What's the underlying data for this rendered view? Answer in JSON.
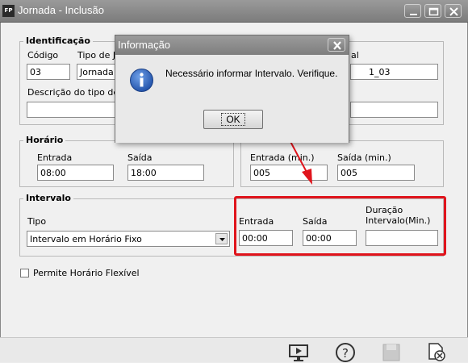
{
  "window": {
    "app_icon_text": "FP",
    "title": "Jornada - Inclusão"
  },
  "identificacao": {
    "group_title": "Identificação",
    "codigo_label": "Código",
    "codigo_value": "03",
    "tipo_label": "Tipo de Jo",
    "tipo_value": "Jornada",
    "partial_label": "al",
    "partial_value": "1_03",
    "descricao_label": "Descrição do tipo de Jo",
    "descricao_value": ""
  },
  "horario": {
    "group_title": "Horário",
    "entrada_label": "Entrada",
    "entrada_value": "08:00",
    "saida_label": "Saída",
    "saida_value": "18:00"
  },
  "variacoes": {
    "entrada_label": "Entrada (min.)",
    "entrada_value": "005",
    "saida_label": "Saída (min.)",
    "saida_value": "005"
  },
  "intervalo": {
    "group_title": "Intervalo",
    "tipo_label": "Tipo",
    "tipo_value": "Intervalo em Horário Fixo",
    "entrada_label": "Entrada",
    "entrada_value": "00:00",
    "saida_label": "Saída",
    "saida_value": "00:00",
    "duracao_label_line1": "Duração",
    "duracao_label_line2": "Intervalo(Min.)",
    "duracao_value": ""
  },
  "flexivel": {
    "label": "Permite Horário Flexível",
    "checked": false
  },
  "dialog": {
    "title": "Informação",
    "message": "Necessário informar Intervalo. Verifique.",
    "ok_label": "OK"
  },
  "toolbar": {
    "icons": [
      "monitor-icon",
      "help-icon",
      "save-icon",
      "close-document-icon"
    ]
  },
  "colors": {
    "highlight": "#e0141c",
    "info_icon": "#2a5db0"
  }
}
